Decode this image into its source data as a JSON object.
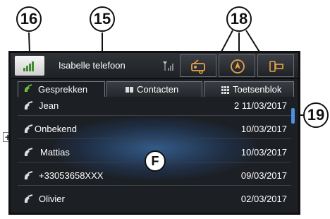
{
  "callouts": {
    "home": "16",
    "phone_name": "15",
    "modes": "18",
    "scrollbar": "19",
    "list_area": "F"
  },
  "header": {
    "phone_name": "Isabelle telefoon"
  },
  "tabs": [
    {
      "label": "Gesprekken",
      "icon": "handset-icon"
    },
    {
      "label": "Contacten",
      "icon": "book-icon"
    },
    {
      "label": "Toetsenblok",
      "icon": "keypad-icon"
    }
  ],
  "calls": [
    {
      "name": "Jean",
      "date": "2 11/03/2017"
    },
    {
      "name": "Onbekend",
      "date": "10/03/2017"
    },
    {
      "name": "Mattias",
      "date": "10/03/2017"
    },
    {
      "name": "+33053658XXX",
      "date": "09/03/2017"
    },
    {
      "name": "Olivier",
      "date": "02/03/2017"
    }
  ],
  "side_controls": {
    "plus": "+"
  },
  "colors": {
    "accent": "#4d8fe0",
    "home_icon": "#3f8b2e",
    "handset": "#6cbf3a"
  }
}
